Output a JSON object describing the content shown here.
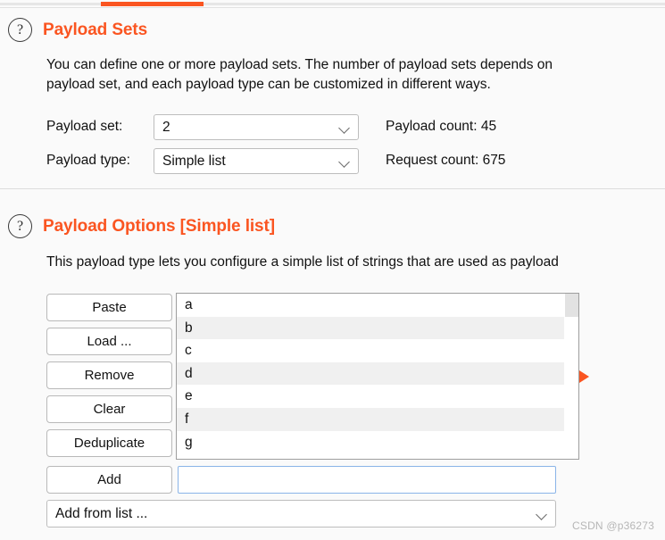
{
  "tab_strip": {
    "active_tab_indicator_color": "#fa5521"
  },
  "payload_sets": {
    "help_icon_glyph": "?",
    "title": "Payload Sets",
    "description_line1": "You can define one or more payload sets. The number of payload sets depends on",
    "description_line2": "payload set, and each payload type can be customized in different ways.",
    "payload_set_label": "Payload set:",
    "payload_set_value": "2",
    "payload_type_label": "Payload type:",
    "payload_type_value": "Simple list",
    "payload_count": "Payload count: 45",
    "request_count": "Request count: 675"
  },
  "payload_options": {
    "help_icon_glyph": "?",
    "title": "Payload Options [Simple list]",
    "description": "This payload type lets you configure a simple list of strings that are used as payload",
    "buttons": [
      {
        "label": "Paste"
      },
      {
        "label": "Load ..."
      },
      {
        "label": "Remove"
      },
      {
        "label": "Clear"
      },
      {
        "label": "Deduplicate"
      }
    ],
    "list_items": [
      "a",
      "b",
      "c",
      "d",
      "e",
      "f",
      "g"
    ],
    "add_button_label": "Add",
    "add_input_value": "",
    "add_input_placeholder": "",
    "add_from_list_label": "Add from list ..."
  },
  "watermark": "CSDN @p36273"
}
